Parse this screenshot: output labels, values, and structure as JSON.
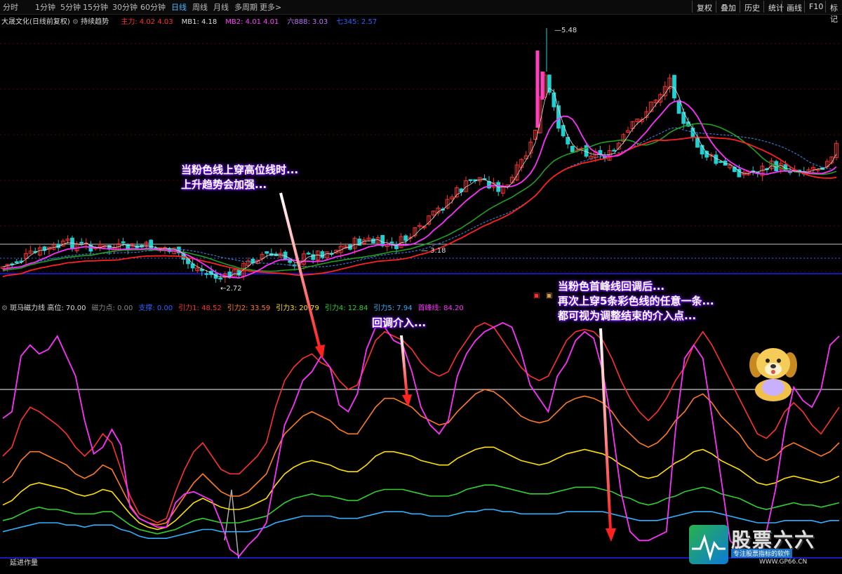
{
  "toolbar": {
    "periods": [
      "分时",
      "1分钟",
      "5分钟",
      "15分钟",
      "30分钟",
      "60分钟",
      "日线",
      "周线",
      "月线",
      "多周期",
      "更多>"
    ],
    "active_index": 6,
    "right_buttons": [
      "复权",
      "叠加",
      "历史",
      "统计",
      "画线",
      "F10",
      "标记"
    ]
  },
  "main_info": {
    "stock": "大晟文化(日线前复权)",
    "indicator": "持续趋势",
    "items": [
      {
        "text": "主力: 4.02   4.03",
        "color": "#ff3030"
      },
      {
        "text": "MB1: 4.18",
        "color": "#dddddd"
      },
      {
        "text": "MB2: 4.01   4.01",
        "color": "#ff40ff"
      },
      {
        "text": "六888: 3.03",
        "color": "#c070ff"
      },
      {
        "text": "七345: 2.57",
        "color": "#3060ff"
      }
    ]
  },
  "price_labels": {
    "high": "5.48",
    "low": "2.72",
    "mid": "3.18"
  },
  "sub_info": {
    "name": "斑马磁力线",
    "items": [
      {
        "text": "高位: 70.00",
        "color": "#dddddd"
      },
      {
        "text": "磁力点: 0.00",
        "color": "#888888"
      },
      {
        "text": "支撑: 0.00",
        "color": "#3060ff"
      },
      {
        "text": "引力1: 48.52",
        "color": "#ff3030"
      },
      {
        "text": "引力2: 33.59",
        "color": "#ff7a20"
      },
      {
        "text": "引力3: 20.79",
        "color": "#ffe000"
      },
      {
        "text": "引力4: 12.84",
        "color": "#30d030"
      },
      {
        "text": "引力5: 7.94",
        "color": "#30b0ff"
      },
      {
        "text": "首峰线: 84.20",
        "color": "#ff30ff"
      }
    ]
  },
  "footer_label": "延进作量",
  "callouts": {
    "c1": [
      "当粉色线上穿高位线时...",
      "上升趋势会加强..."
    ],
    "c2": [
      "回调介入..."
    ],
    "c3": [
      "当粉色首峰线回调后...",
      "再次上穿5条彩色线的任意一条...",
      "都可视为调整结束的介入点..."
    ]
  },
  "logo": {
    "title": "股票六六",
    "sub": "专注股票指标的软件",
    "url": "WWW.GP66.CN"
  },
  "colors": {
    "up": "#ff3030",
    "down": "#20d0d0",
    "pink": "#ff30ff",
    "high_line": "#c8c8c8",
    "support_line": "#2020ff"
  },
  "chart_data": {
    "type": "line",
    "title": "斑马磁力线",
    "high_line": 70,
    "series": [
      {
        "name": "首峰线",
        "color": "#ff30ff",
        "values": [
          57,
          60,
          85,
          90,
          86,
          88,
          94,
          85,
          76,
          56,
          41,
          44,
          52,
          45,
          17,
          12,
          10,
          8,
          8,
          19,
          23,
          24,
          22,
          20,
          10,
          -2,
          -5,
          0,
          4,
          10,
          32,
          54,
          63,
          74,
          78,
          85,
          80,
          63,
          60,
          68,
          88,
          98,
          98,
          92,
          90,
          78,
          62,
          54,
          50,
          56,
          76,
          86,
          92,
          96,
          98,
          100,
          98,
          87,
          72,
          66,
          60,
          76,
          82,
          92,
          96,
          93,
          78,
          54,
          24,
          6,
          2,
          2,
          4,
          6,
          52,
          84,
          90,
          84,
          58,
          30,
          2,
          -2,
          -4,
          0,
          6,
          25,
          52,
          71,
          65,
          62,
          70,
          90,
          94
        ]
      },
      {
        "name": "引力1",
        "color": "#ff3030",
        "values": [
          40,
          44,
          56,
          62,
          60,
          57,
          54,
          50,
          44,
          40,
          44,
          50,
          46,
          34,
          22,
          14,
          12,
          10,
          12,
          24,
          34,
          42,
          46,
          40,
          34,
          32,
          32,
          36,
          40,
          46,
          62,
          74,
          80,
          84,
          86,
          82,
          80,
          74,
          70,
          72,
          82,
          92,
          96,
          94,
          92,
          88,
          82,
          78,
          76,
          78,
          86,
          92,
          98,
          100,
          98,
          92,
          86,
          80,
          76,
          74,
          76,
          84,
          92,
          96,
          97,
          96,
          92,
          84,
          74,
          66,
          60,
          56,
          60,
          66,
          74,
          80,
          90,
          96,
          90,
          82,
          74,
          66,
          58,
          50,
          48,
          52,
          60,
          64,
          60,
          54,
          50,
          56,
          62
        ]
      },
      {
        "name": "引力2",
        "color": "#ff7a20",
        "values": [
          28,
          31,
          38,
          42,
          42,
          40,
          38,
          36,
          32,
          30,
          32,
          36,
          34,
          26,
          18,
          12,
          10,
          9,
          10,
          16,
          22,
          28,
          32,
          28,
          24,
          22,
          22,
          24,
          28,
          32,
          42,
          50,
          54,
          58,
          60,
          58,
          56,
          52,
          50,
          50,
          56,
          62,
          66,
          66,
          64,
          62,
          58,
          56,
          54,
          55,
          60,
          64,
          68,
          70,
          69,
          66,
          62,
          58,
          56,
          55,
          56,
          60,
          64,
          66,
          67,
          66,
          64,
          60,
          54,
          50,
          46,
          44,
          46,
          50,
          56,
          60,
          66,
          68,
          64,
          58,
          54,
          50,
          44,
          40,
          38,
          40,
          44,
          46,
          44,
          42,
          40,
          42,
          46
        ]
      },
      {
        "name": "引力3",
        "color": "#ffe000",
        "values": [
          18,
          20,
          24,
          27,
          28,
          27,
          26,
          25,
          23,
          22,
          23,
          25,
          24,
          19,
          14,
          10,
          8,
          7,
          8,
          11,
          15,
          19,
          21,
          19,
          17,
          16,
          16,
          17,
          19,
          21,
          27,
          32,
          35,
          37,
          38,
          37,
          36,
          34,
          33,
          33,
          36,
          40,
          42,
          42,
          41,
          40,
          38,
          37,
          36,
          36,
          39,
          41,
          43,
          44,
          44,
          42,
          40,
          38,
          37,
          36,
          37,
          39,
          41,
          42,
          43,
          42,
          41,
          39,
          36,
          34,
          31,
          30,
          31,
          34,
          37,
          39,
          42,
          43,
          41,
          38,
          36,
          34,
          31,
          28,
          27,
          28,
          30,
          31,
          30,
          29,
          28,
          29,
          31
        ]
      },
      {
        "name": "引力4",
        "color": "#30d030",
        "values": [
          11,
          12,
          14,
          16,
          17,
          16,
          16,
          15,
          14,
          14,
          14,
          15,
          15,
          12,
          9,
          7,
          6,
          5,
          6,
          7,
          9,
          11,
          12,
          11,
          10,
          10,
          10,
          11,
          12,
          13,
          16,
          19,
          21,
          22,
          23,
          22,
          22,
          21,
          20,
          20,
          22,
          24,
          25,
          25,
          25,
          24,
          23,
          22,
          22,
          22,
          23,
          25,
          26,
          27,
          27,
          26,
          25,
          24,
          23,
          23,
          23,
          24,
          25,
          26,
          26,
          26,
          25,
          24,
          22,
          21,
          19,
          18,
          19,
          21,
          22,
          24,
          25,
          26,
          25,
          23,
          22,
          21,
          19,
          17,
          16,
          17,
          18,
          19,
          18,
          18,
          17,
          18,
          19
        ]
      },
      {
        "name": "引力5",
        "color": "#30b0ff",
        "values": [
          6,
          7,
          8,
          9,
          10,
          10,
          10,
          9,
          9,
          8,
          9,
          9,
          9,
          7,
          6,
          4,
          3,
          3,
          3,
          4,
          5,
          6,
          7,
          7,
          6,
          6,
          6,
          6,
          7,
          8,
          10,
          11,
          12,
          13,
          13,
          13,
          13,
          12,
          12,
          12,
          13,
          14,
          15,
          15,
          15,
          14,
          14,
          13,
          13,
          13,
          14,
          15,
          15,
          16,
          16,
          15,
          15,
          14,
          14,
          14,
          14,
          14,
          15,
          15,
          15,
          15,
          15,
          14,
          13,
          12,
          11,
          11,
          11,
          12,
          13,
          14,
          15,
          15,
          15,
          14,
          13,
          12,
          11,
          10,
          10,
          10,
          11,
          11,
          11,
          11,
          10,
          11,
          11
        ]
      }
    ]
  }
}
